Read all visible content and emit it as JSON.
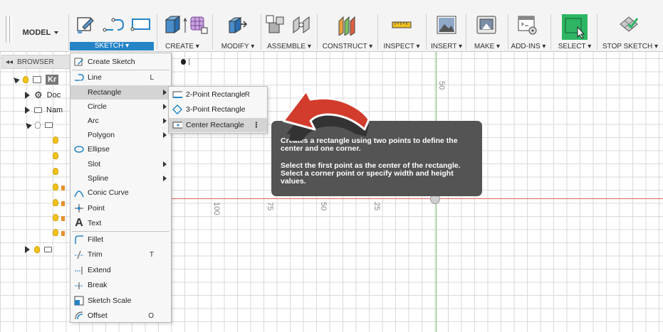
{
  "toolbar": {
    "model_label": "MODEL",
    "groups": [
      {
        "label": "SKETCH"
      },
      {
        "label": "CREATE"
      },
      {
        "label": "MODIFY"
      },
      {
        "label": "ASSEMBLE"
      },
      {
        "label": "CONSTRUCT"
      },
      {
        "label": "INSPECT"
      },
      {
        "label": "INSERT"
      },
      {
        "label": "MAKE"
      },
      {
        "label": "ADD-INS"
      },
      {
        "label": "SELECT"
      },
      {
        "label": "STOP SKETCH"
      }
    ],
    "accent_color": "#2484c6"
  },
  "browser": {
    "title": "BROWSER",
    "rows": [
      {
        "label": "Kr"
      },
      {
        "label": "Doc"
      },
      {
        "label": "Nam"
      }
    ]
  },
  "sketch_menu": {
    "items": [
      {
        "label": "Create Sketch",
        "shortcut": ""
      },
      {
        "label": "Line",
        "shortcut": "L"
      },
      {
        "label": "Rectangle",
        "shortcut": ""
      },
      {
        "label": "Circle",
        "shortcut": ""
      },
      {
        "label": "Arc",
        "shortcut": ""
      },
      {
        "label": "Polygon",
        "shortcut": ""
      },
      {
        "label": "Ellipse",
        "shortcut": ""
      },
      {
        "label": "Slot",
        "shortcut": ""
      },
      {
        "label": "Spline",
        "shortcut": ""
      },
      {
        "label": "Conic Curve",
        "shortcut": ""
      },
      {
        "label": "Point",
        "shortcut": ""
      },
      {
        "label": "Text",
        "shortcut": ""
      },
      {
        "label": "Fillet",
        "shortcut": ""
      },
      {
        "label": "Trim",
        "shortcut": "T"
      },
      {
        "label": "Extend",
        "shortcut": ""
      },
      {
        "label": "Break",
        "shortcut": ""
      },
      {
        "label": "Sketch Scale",
        "shortcut": ""
      },
      {
        "label": "Offset",
        "shortcut": "O"
      }
    ]
  },
  "rectangle_submenu": {
    "items": [
      {
        "label": "2-Point Rectangle",
        "shortcut": "R"
      },
      {
        "label": "3-Point Rectangle",
        "shortcut": ""
      },
      {
        "label": "Center Rectangle",
        "shortcut": "⋮"
      }
    ]
  },
  "tooltip": {
    "line1": "Creates a rectangle using two points to define the center and one corner.",
    "line2": "Select the first point as the center of the rectangle. Select a corner point or specify width and height values."
  },
  "ruler": {
    "h_labels": [
      "100",
      "75",
      "50",
      "25"
    ],
    "v_label": "50"
  }
}
